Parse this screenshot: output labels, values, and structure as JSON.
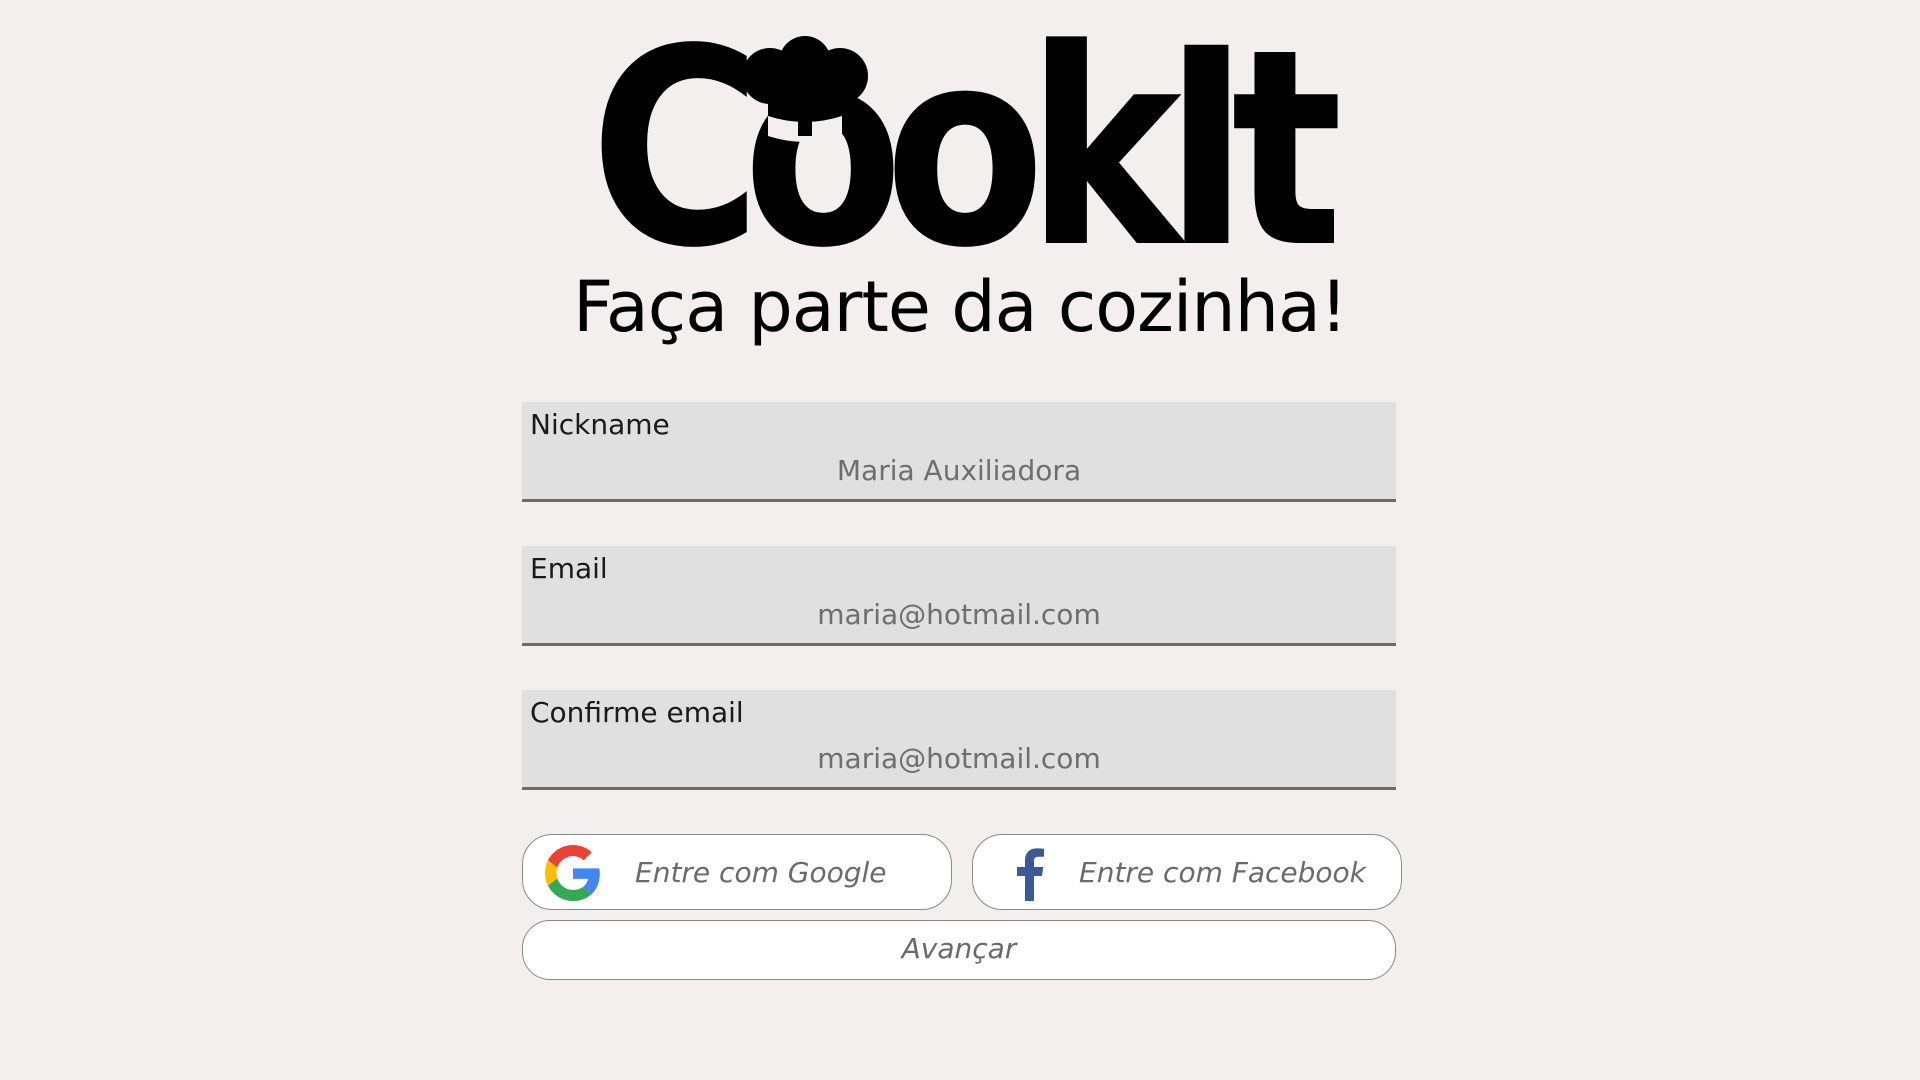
{
  "brand": {
    "logo_text": "CookIt",
    "tagline": "Faça parte da cozinha!"
  },
  "form": {
    "nickname": {
      "label": "Nickname",
      "value": "Maria Auxiliadora"
    },
    "email": {
      "label": "Email",
      "value": "maria@hotmail.com"
    },
    "confirm_email": {
      "label": "Confirme email",
      "value": "maria@hotmail.com"
    }
  },
  "buttons": {
    "google_label": "Entre com Google",
    "facebook_label": "Entre com Facebook",
    "advance_label": "Avançar"
  },
  "icons": {
    "google": "google-icon",
    "facebook": "facebook-icon",
    "chef_hat": "chef-hat-icon"
  },
  "colors": {
    "background": "#f2efee",
    "field_background": "#e0e0e0",
    "field_underline": "#6b6b6b",
    "facebook_blue": "#3b5998"
  }
}
